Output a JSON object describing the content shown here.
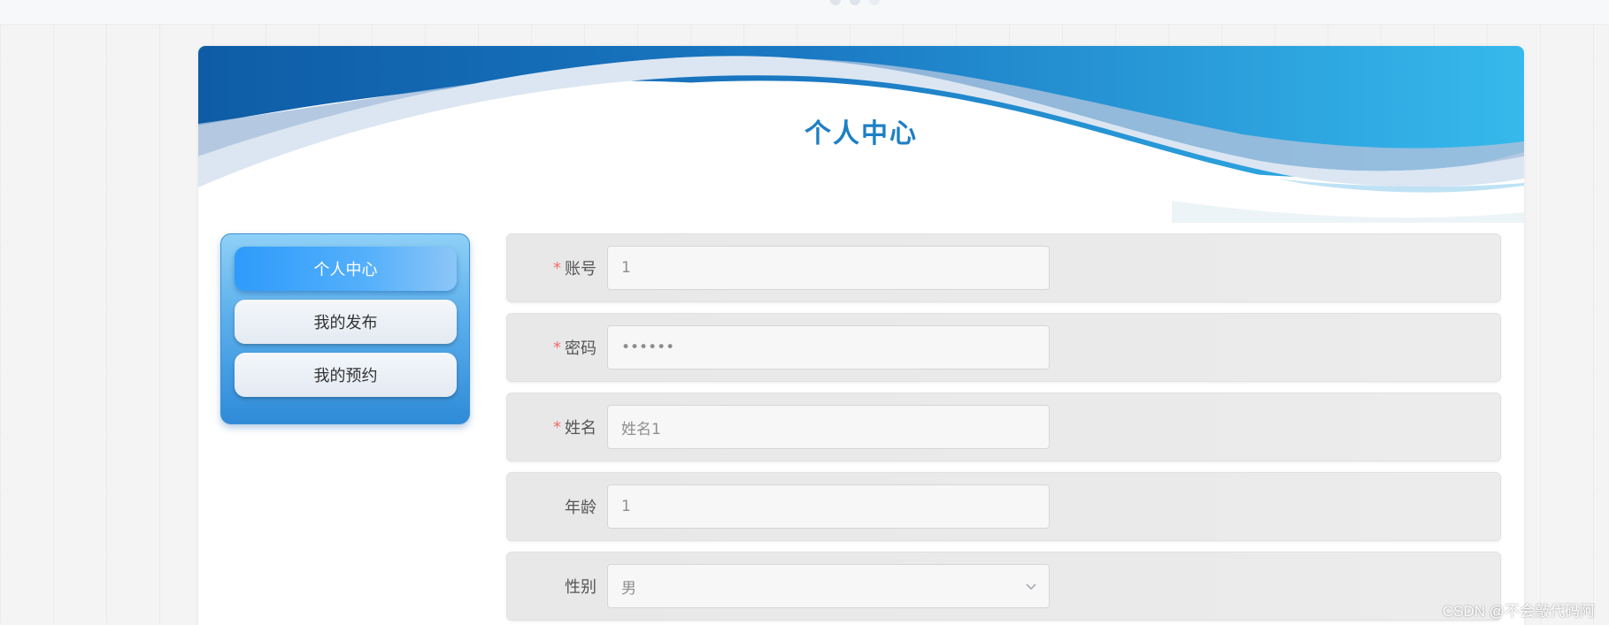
{
  "page": {
    "title": "个人中心"
  },
  "side_menu": {
    "items": [
      {
        "label": "个人中心",
        "active": true
      },
      {
        "label": "我的发布",
        "active": false
      },
      {
        "label": "我的预约",
        "active": false
      }
    ]
  },
  "form": {
    "required_mark": "*",
    "fields": [
      {
        "label": "账号",
        "required": true,
        "value": "1"
      },
      {
        "label": "密码",
        "required": true,
        "value": "123456"
      },
      {
        "label": "姓名",
        "required": true,
        "value": "姓名1"
      },
      {
        "label": "年龄",
        "required": false,
        "value": "1"
      },
      {
        "label": "性别",
        "required": false,
        "value": "男",
        "type": "select"
      }
    ]
  },
  "watermark": "CSDN @不会敲代码阿",
  "colors": {
    "title": "#1e7fc4",
    "menu_active_start": "#2e9bfb",
    "required": "#f56c6c",
    "wave_dark": "#0e5ca6",
    "wave_light": "#36b9ec"
  },
  "icons": {
    "select_arrow": "chevron-down-icon"
  }
}
